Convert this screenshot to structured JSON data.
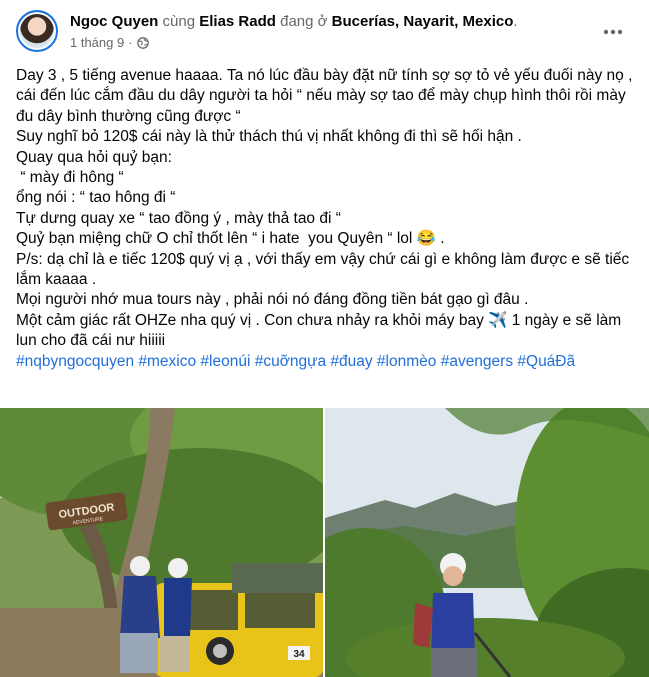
{
  "post": {
    "author": "Ngoc Quyen",
    "with_word": " cùng ",
    "tagged": "Elias Radd",
    "at_word": " đang ở ",
    "location": "Bucerías, Nayarit, Mexico",
    "period": ".",
    "date": "1 tháng 9",
    "separator": "·",
    "privacy_icon": "globe-icon",
    "more_icon": "more-options-icon",
    "lines": [
      "Day 3 , 5 tiếng avenue haaaa. Ta nó lúc đầu bày đặt nữ tính sợ sợ tỏ vẻ yếu đuối này nọ , cái đến lúc cắm đầu du dây người ta hỏi “ nếu mày sợ tao để mày chụp hình thôi rồi mày đu dây bình thường cũng được “",
      "Suy nghĩ bỏ 120$ cái này là thử thách thú vị nhất không đi thì sẽ hối hận .",
      "Quay qua hỏi quỷ bạn:",
      " “ mày đi hông “",
      "ổng nói : “ tao hông đi “",
      "Tự dưng quay xe “ tao đồng ý , mày thả tao đi “",
      "Quỷ bạn miệng chữ O chỉ thốt lên “ i hate  you Quyên “ lol 😂 .",
      "P/s: dạ chỉ là e tiếc 120$ quý vị ạ , với thấy em vậy chứ cái gì e không làm được e sẽ tiếc lắm kaaaa .",
      "Mọi người nhớ mua tours này , phải nói nó đáng đồng tiền bát gạo gì đâu .",
      "Một cảm giác rất OHZe nha quý vị . Con chưa nhảy ra khỏi máy bay ✈️ 1 ngày e sẽ làm lun cho đã cái nư hiiiii"
    ],
    "hashtags": "#nqbyngocquyen #mexico #leonúi #cuỡngựa #đuay #lonmèo #avengers #QuáĐã"
  },
  "photos": {
    "left_sign": "OUTDOOR",
    "left_sign_sub": "ADVENTURE",
    "truck_plate": "34"
  },
  "colors": {
    "link": "#216fdb",
    "muted": "#65676b",
    "text": "#050505"
  }
}
